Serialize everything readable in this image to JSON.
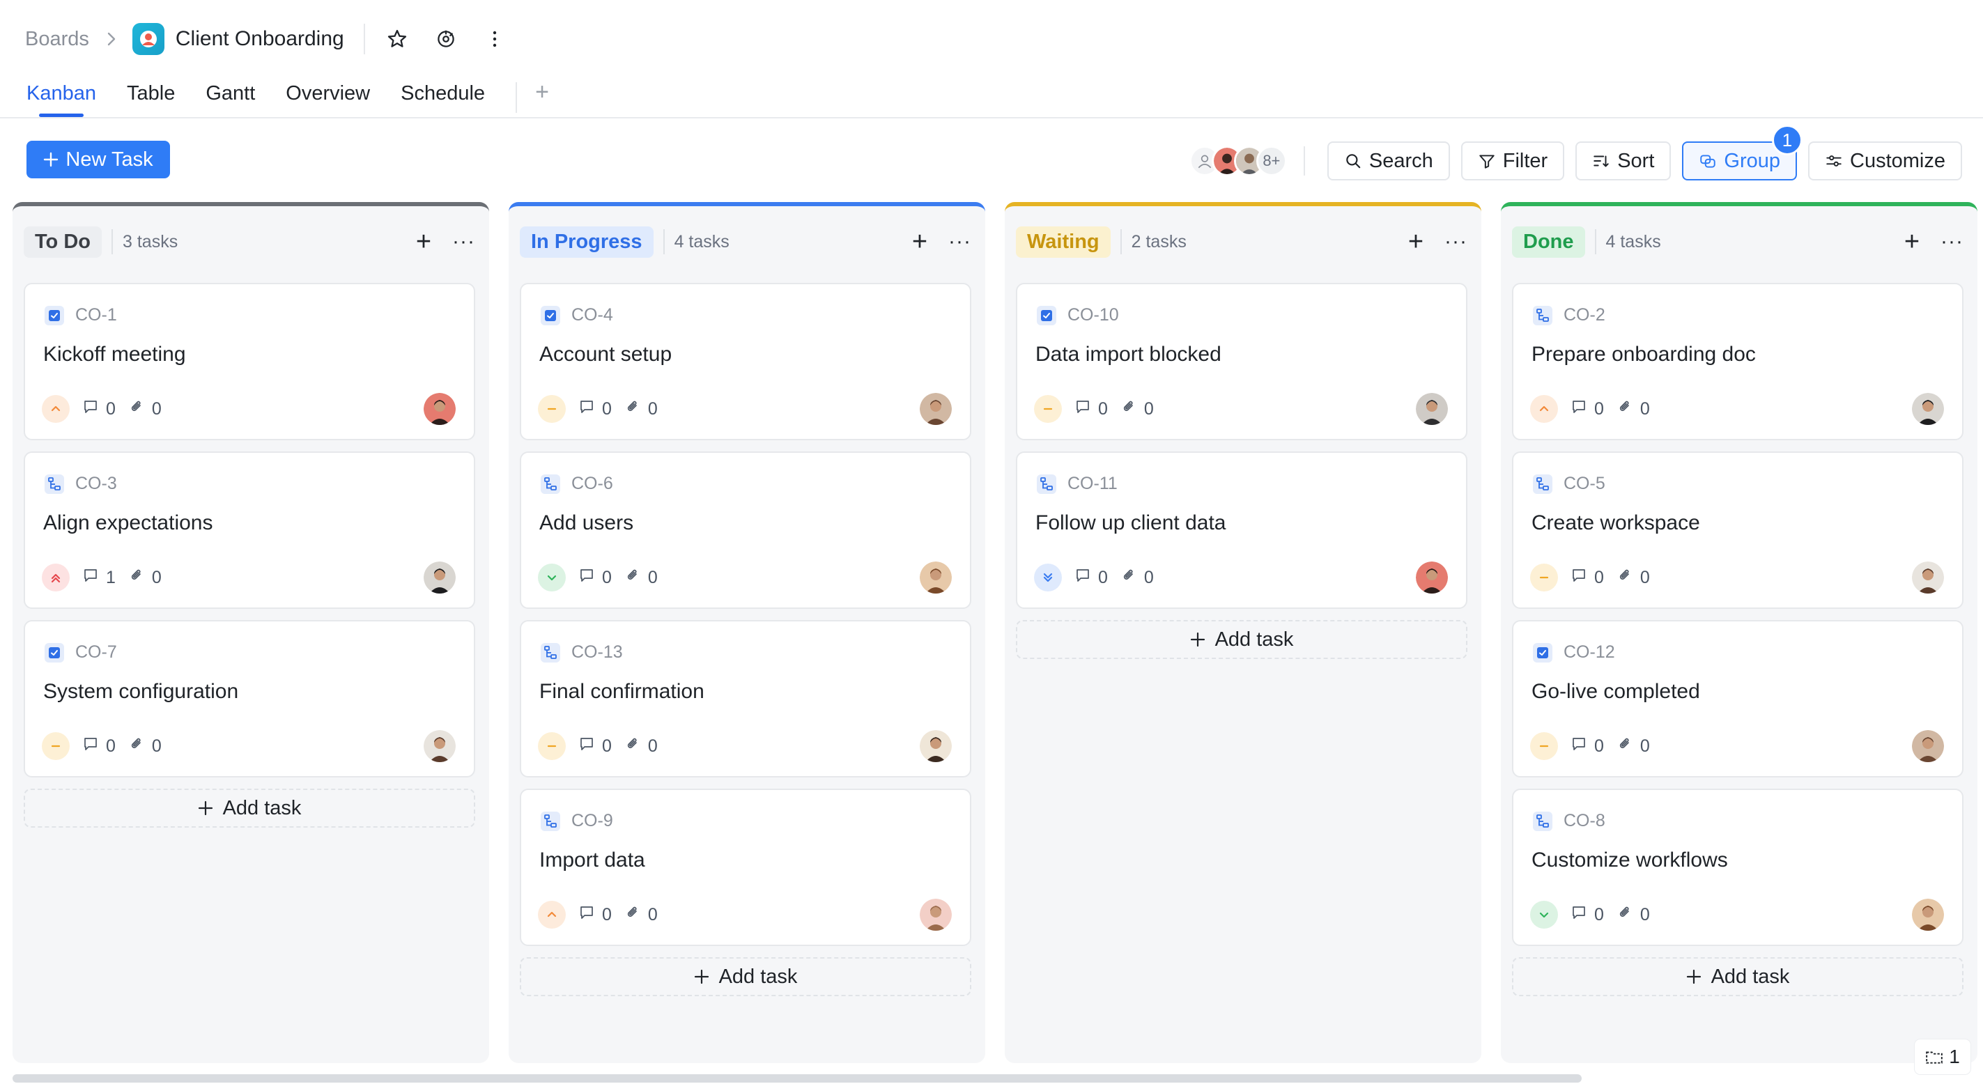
{
  "breadcrumb": {
    "root": "Boards",
    "title": "Client Onboarding"
  },
  "tabs": [
    {
      "label": "Kanban",
      "active": true
    },
    {
      "label": "Table"
    },
    {
      "label": "Gantt"
    },
    {
      "label": "Overview"
    },
    {
      "label": "Schedule"
    }
  ],
  "toolbar": {
    "new_task": "New Task",
    "members_more": "8+",
    "search": "Search",
    "filter": "Filter",
    "sort": "Sort",
    "group": "Group",
    "group_badge": "1",
    "customize": "Customize"
  },
  "colors": {
    "accent": "#2f7cf6",
    "todo": "#6b6f75",
    "in_progress": "#3b7cf0",
    "waiting": "#e5b324",
    "done": "#2fb35b"
  },
  "columns": [
    {
      "title": "To Do",
      "count": "3 tasks",
      "cards": [
        {
          "key": "CO-1",
          "title": "Kickoff meeting",
          "type": "task-icon",
          "priority": "medium-high",
          "comments": "0",
          "attachments": "0"
        },
        {
          "key": "CO-3",
          "title": "Align expectations",
          "type": "subtask-icon",
          "priority": "highest",
          "comments": "1",
          "attachments": "0"
        },
        {
          "key": "CO-7",
          "title": "System configuration",
          "type": "task-icon",
          "priority": "medium",
          "comments": "0",
          "attachments": "0"
        }
      ],
      "add_task": "Add task"
    },
    {
      "title": "In Progress",
      "count": "4 tasks",
      "cards": [
        {
          "key": "CO-4",
          "title": "Account setup",
          "type": "task-icon",
          "priority": "medium",
          "comments": "0",
          "attachments": "0"
        },
        {
          "key": "CO-6",
          "title": "Add users",
          "type": "subtask-icon",
          "priority": "low",
          "comments": "0",
          "attachments": "0"
        },
        {
          "key": "CO-13",
          "title": "Final confirmation",
          "type": "subtask-icon",
          "priority": "medium",
          "comments": "0",
          "attachments": "0"
        },
        {
          "key": "CO-9",
          "title": "Import data",
          "type": "subtask-icon",
          "priority": "medium-high",
          "comments": "0",
          "attachments": "0"
        }
      ],
      "add_task": "Add task"
    },
    {
      "title": "Waiting",
      "count": "2 tasks",
      "cards": [
        {
          "key": "CO-10",
          "title": "Data import blocked",
          "type": "task-icon",
          "priority": "medium",
          "comments": "0",
          "attachments": "0"
        },
        {
          "key": "CO-11",
          "title": "Follow up client data",
          "type": "subtask-icon",
          "priority": "lowest",
          "comments": "0",
          "attachments": "0"
        }
      ],
      "add_task": "Add task"
    },
    {
      "title": "Done",
      "count": "4 tasks",
      "cards": [
        {
          "key": "CO-2",
          "title": "Prepare onboarding doc",
          "type": "subtask-icon",
          "priority": "medium-high",
          "comments": "0",
          "attachments": "0"
        },
        {
          "key": "CO-5",
          "title": "Create workspace",
          "type": "subtask-icon",
          "priority": "medium",
          "comments": "0",
          "attachments": "0"
        },
        {
          "key": "CO-12",
          "title": "Go-live completed",
          "type": "task-icon",
          "priority": "medium",
          "comments": "0",
          "attachments": "0"
        },
        {
          "key": "CO-8",
          "title": "Customize workflows",
          "type": "subtask-icon",
          "priority": "low",
          "comments": "0",
          "attachments": "0"
        }
      ],
      "add_task": "Add task"
    }
  ],
  "corner_widget": {
    "count": "1"
  }
}
